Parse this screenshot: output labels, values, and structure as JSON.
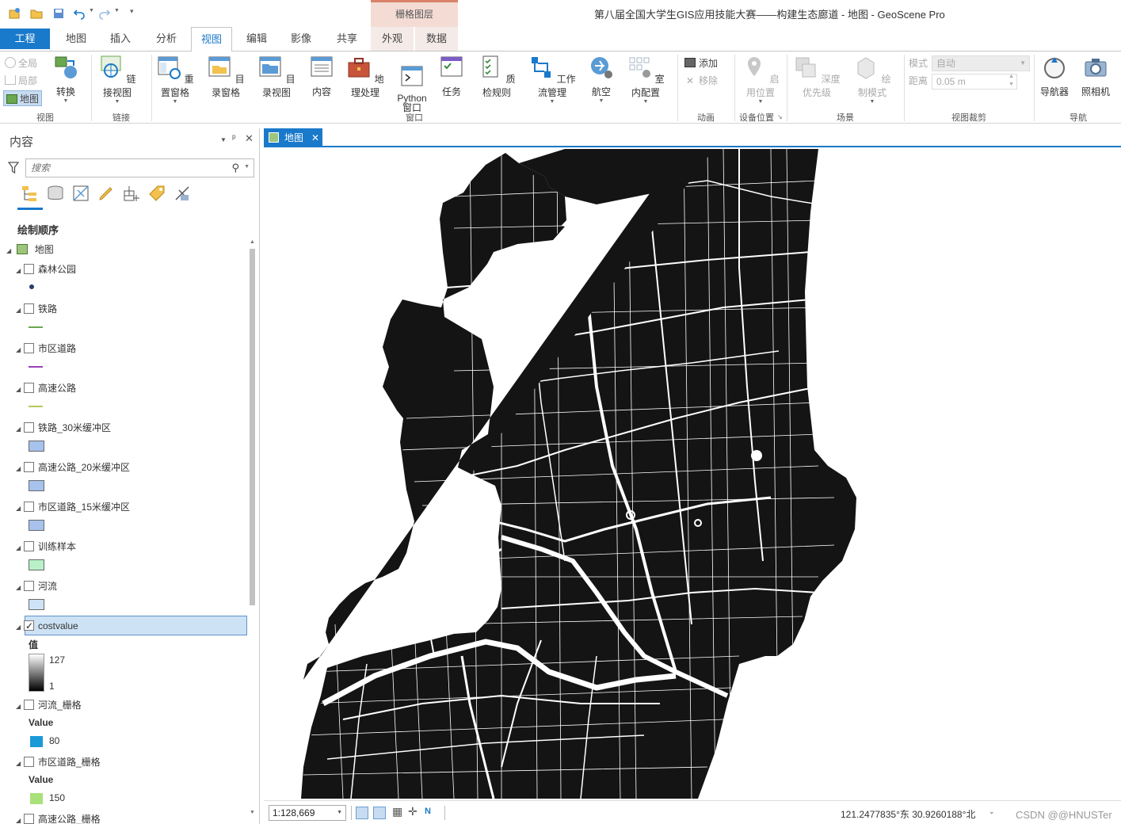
{
  "window": {
    "title": "第八届全国大学生GIS应用技能大赛——构建生态廊道 - 地图 - GeoScene Pro",
    "context_tab_group": "栅格图层"
  },
  "tabs": [
    {
      "label": "工程"
    },
    {
      "label": "地图"
    },
    {
      "label": "插入"
    },
    {
      "label": "分析"
    },
    {
      "label": "视图"
    },
    {
      "label": "编辑"
    },
    {
      "label": "影像"
    },
    {
      "label": "共享"
    },
    {
      "label": "外观"
    },
    {
      "label": "数据"
    }
  ],
  "ribbon": {
    "view_group": {
      "quanju": "全局",
      "jubu": "局部",
      "ditu": "地图",
      "zhuanhuan": "转换",
      "label": "视图"
    },
    "link_group": {
      "lianjie": "链接视图",
      "label": "链接"
    },
    "window_group": {
      "buttons": [
        "重置窗格",
        "目录窗格",
        "目录视图",
        "内容",
        "地理处理",
        "Python\n窗口",
        "任务",
        "质检规则",
        "工作流管理",
        "航空",
        "室内配置"
      ],
      "label": "窗口"
    },
    "animation_group": {
      "add": "添加",
      "remove": "移除",
      "label": "动画"
    },
    "device_group": {
      "enable": "启用位置",
      "label": "设备位置"
    },
    "scene_group": {
      "depth": "深度优先级",
      "draw_mode": "绘制模式",
      "label": "场景"
    },
    "clip_group": {
      "mode_label": "模式",
      "mode_value": "自动",
      "distance_label": "距离",
      "distance_value": "0.05 m",
      "label": "视图裁剪"
    },
    "nav_group": {
      "navigator": "导航器",
      "camera": "照相机",
      "label": "导航"
    }
  },
  "contents": {
    "title": "内容",
    "search_placeholder": "搜索",
    "draw_order": "绘制顺序",
    "map_name": "地图",
    "layers": [
      {
        "name": "森林公园",
        "checked": false
      },
      {
        "name": "铁路",
        "checked": false
      },
      {
        "name": "市区道路",
        "checked": false
      },
      {
        "name": "高速公路",
        "checked": false
      },
      {
        "name": "铁路_30米缓冲区",
        "checked": false
      },
      {
        "name": "高速公路_20米缓冲区",
        "checked": false
      },
      {
        "name": "市区道路_15米缓冲区",
        "checked": false
      },
      {
        "name": "训练样本",
        "checked": false
      },
      {
        "name": "河流",
        "checked": false
      },
      {
        "name": "costvalue",
        "checked": true
      },
      {
        "name": "河流_栅格",
        "checked": false
      },
      {
        "name": "市区道路_栅格",
        "checked": false
      },
      {
        "name": "高速公路_栅格",
        "checked": false
      }
    ],
    "costvalue_legend": {
      "label": "值",
      "max": "127",
      "min": "1"
    },
    "river_raster_legend": {
      "label": "Value",
      "value": "80"
    },
    "road_raster_legend": {
      "label": "Value",
      "value": "150"
    }
  },
  "map": {
    "tab_label": "地图",
    "scale": "1:128,669",
    "coordinates": "121.2477835°东 30.9260188°北"
  },
  "watermark": "CSDN @@HNUSTer",
  "colors": {
    "accent": "#1979ca",
    "map_fill": "#111111"
  }
}
